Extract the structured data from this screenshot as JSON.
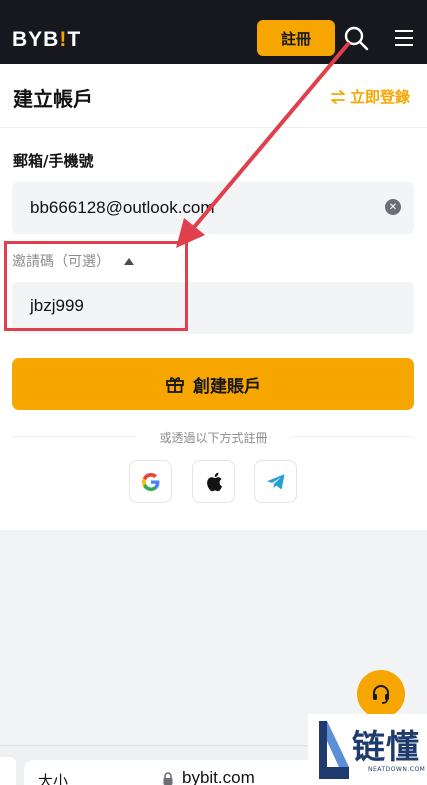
{
  "header": {
    "logo_prefix": "BYB",
    "logo_bar": "!",
    "logo_suffix": "T",
    "register_label": "註冊",
    "search_icon": "search-icon",
    "menu_icon": "hamburger-menu-icon"
  },
  "page": {
    "title": "建立帳戶",
    "login_link": "立即登錄"
  },
  "form": {
    "email_label": "郵箱/手機號",
    "email_value": "bb666128@outlook.com",
    "invite_label": "邀請碼（可選）",
    "invite_value": "jbzj999",
    "create_label": "創建賬戶",
    "or_text": "或透過以下方式註冊"
  },
  "social": [
    "google-icon",
    "apple-icon",
    "telegram-icon"
  ],
  "browser": {
    "text_size": "大小",
    "url": "bybit.com"
  },
  "watermark": {
    "text": "链懂",
    "sub": "NEATDOWN.COM"
  },
  "colors": {
    "accent": "#f7a600",
    "header_bg": "#17181e",
    "annotation": "#e0404b"
  }
}
